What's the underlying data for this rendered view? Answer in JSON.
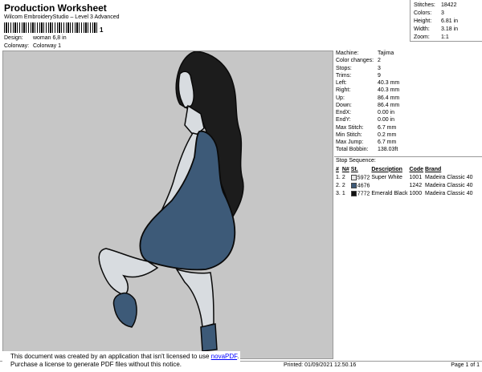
{
  "header": {
    "title": "Production Worksheet",
    "subtitle": "Wilcom EmbroideryStudio – Level 3 Advanced",
    "barcode_trail": "1",
    "design_label": "Design:",
    "design_value": "woman 6,8 in",
    "colorway_label": "Colorway:",
    "colorway_value": "Colorway 1"
  },
  "stats": [
    {
      "label": "Stitches:",
      "value": "18422"
    },
    {
      "label": "Colors:",
      "value": "3"
    },
    {
      "label": "Height:",
      "value": "6.81 in"
    },
    {
      "label": "Width:",
      "value": "3.18 in"
    },
    {
      "label": "Zoom:",
      "value": "1:1"
    }
  ],
  "machine_info": [
    {
      "label": "Machine:",
      "value": "Tajima"
    },
    {
      "label": "Color changes:",
      "value": "2"
    },
    {
      "label": "Stops:",
      "value": "3"
    },
    {
      "label": "Trims:",
      "value": "9"
    },
    {
      "label": "Left:",
      "value": "40.3 mm"
    },
    {
      "label": "Right:",
      "value": "40.3 mm"
    },
    {
      "label": "Up:",
      "value": "86.4 mm"
    },
    {
      "label": "Down:",
      "value": "86.4 mm"
    },
    {
      "label": "EndX:",
      "value": "0.00 in"
    },
    {
      "label": "EndY:",
      "value": "0.00 in"
    },
    {
      "label": "Max Stitch:",
      "value": "6.7 mm"
    },
    {
      "label": "Min Stitch:",
      "value": "0.2 mm"
    },
    {
      "label": "Max Jump:",
      "value": "6.7 mm"
    },
    {
      "label": "Total Bobbin:",
      "value": "138.03ft"
    }
  ],
  "stop_sequence": {
    "title": "Stop Sequence:",
    "columns": [
      "#",
      "N#",
      "St.",
      "Description",
      "Code",
      "Brand"
    ],
    "rows": [
      {
        "num": "1.",
        "n": "2",
        "swatch": "#e8e8e8",
        "st": "5972",
        "desc": "Super White",
        "code": "1001",
        "brand": "Madeira Classic 40"
      },
      {
        "num": "2.",
        "n": "2",
        "swatch": "#3d5a78",
        "st": "4676",
        "desc": "",
        "code": "1242",
        "brand": "Madeira Classic 40"
      },
      {
        "num": "3.",
        "n": "1",
        "swatch": "#111111",
        "st": "7772",
        "desc": "Emerald Black",
        "code": "1000",
        "brand": "Madeira Classic 40"
      }
    ]
  },
  "colors": {
    "canvas": "#c6c6c6",
    "skin": "#d8dce0",
    "dress": "#3d5a78",
    "hair": "#1c1c1c",
    "outline": "#0a0a0a"
  },
  "notice": {
    "line1_prefix": "This document was created by an application that isn't licensed to use ",
    "link": "novaPDF",
    "line1_suffix": ".",
    "line2": "Purchase a license to generate PDF files without this notice."
  },
  "footer": {
    "left": "Cr",
    "printed": "Printed: 01/09/2021 12.50.16",
    "page": "Page 1 of 1"
  }
}
